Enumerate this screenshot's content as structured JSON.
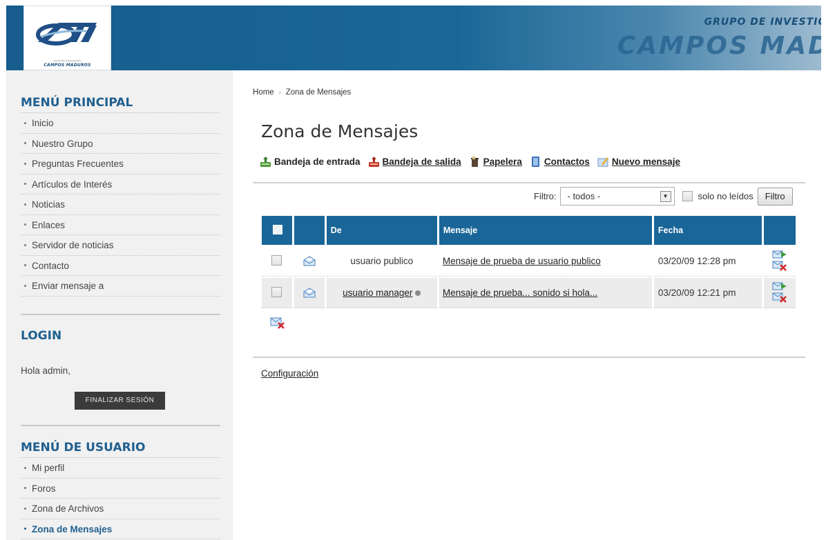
{
  "header": {
    "logo_text": "CAMPOS MADUROS",
    "logo_subtext": "GRUPO DE INVESTIGACIÓN",
    "brand_top": "GRUPO DE INVESTIG",
    "brand_main": "CAMPOS MAD"
  },
  "sidebar": {
    "main_menu": {
      "title": "MENÚ PRINCIPAL",
      "items": [
        "Inicio",
        "Nuestro Grupo",
        "Preguntas Frecuentes",
        "Artículos de Interés",
        "Noticias",
        "Enlaces",
        "Servidor de noticias",
        "Contacto",
        "Enviar mensaje a"
      ]
    },
    "login": {
      "title": "LOGIN",
      "greeting": "Hola admin,",
      "logout_label": "FINALIZAR SESIÓN"
    },
    "user_menu": {
      "title": "MENÚ DE USUARIO",
      "items": [
        "Mi perfil",
        "Foros",
        "Zona de Archivos",
        "Zona de Mensajes"
      ],
      "active_index": 3
    }
  },
  "breadcrumb": {
    "home": "Home",
    "separator": "›",
    "current": "Zona de Mensajes"
  },
  "page_title": "Zona de Mensajes",
  "toolbar": {
    "inbox": "Bandeja de entrada",
    "outbox": "Bandeja de salida",
    "trash": "Papelera",
    "contacts": "Contactos",
    "new_message": "Nuevo mensaje"
  },
  "filter": {
    "label": "Filtro:",
    "selected": "- todos -",
    "unread_label": "solo no leídos",
    "button": "Filtro"
  },
  "table": {
    "columns": {
      "from": "De",
      "message": "Mensaje",
      "date": "Fecha"
    },
    "rows": [
      {
        "from": "usuario publico",
        "message": "Mensaje de prueba de usuario publico",
        "date": "03/20/09 12:28 pm"
      },
      {
        "from": "usuario manager",
        "message": "Mensaje de prueba... sonido si hola...",
        "date": "03/20/09 12:21 pm"
      }
    ]
  },
  "footer_link": "Configuración",
  "colors": {
    "header_blue": "#165d8d",
    "table_header": "#1a6698",
    "sidebar_title": "#1f5f8f",
    "sidebar_bg": "#f1f1f1"
  }
}
